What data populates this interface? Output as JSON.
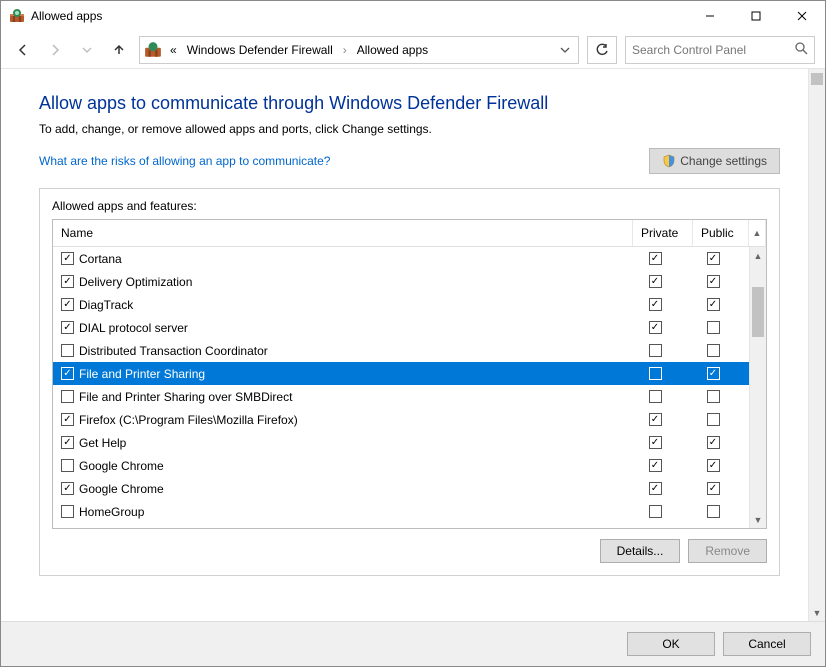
{
  "window": {
    "title": "Allowed apps"
  },
  "breadcrumb": {
    "prefix": "«",
    "seg1": "Windows Defender Firewall",
    "seg2": "Allowed apps"
  },
  "search": {
    "placeholder": "Search Control Panel"
  },
  "page": {
    "heading": "Allow apps to communicate through Windows Defender Firewall",
    "subheading": "To add, change, or remove allowed apps and ports, click Change settings.",
    "risks_link": "What are the risks of allowing an app to communicate?",
    "change_settings": "Change settings",
    "panel_label": "Allowed apps and features:",
    "columns": {
      "name": "Name",
      "private": "Private",
      "public": "Public"
    },
    "details_btn": "Details...",
    "remove_btn": "Remove"
  },
  "rows": [
    {
      "enabled": true,
      "name": "Cortana",
      "private": true,
      "public": true,
      "selected": false
    },
    {
      "enabled": true,
      "name": "Delivery Optimization",
      "private": true,
      "public": true,
      "selected": false
    },
    {
      "enabled": true,
      "name": "DiagTrack",
      "private": true,
      "public": true,
      "selected": false
    },
    {
      "enabled": true,
      "name": "DIAL protocol server",
      "private": true,
      "public": false,
      "selected": false
    },
    {
      "enabled": false,
      "name": "Distributed Transaction Coordinator",
      "private": false,
      "public": false,
      "selected": false
    },
    {
      "enabled": true,
      "name": "File and Printer Sharing",
      "private": false,
      "public": true,
      "selected": true
    },
    {
      "enabled": false,
      "name": "File and Printer Sharing over SMBDirect",
      "private": false,
      "public": false,
      "selected": false
    },
    {
      "enabled": true,
      "name": "Firefox (C:\\Program Files\\Mozilla Firefox)",
      "private": true,
      "public": false,
      "selected": false
    },
    {
      "enabled": true,
      "name": "Get Help",
      "private": true,
      "public": true,
      "selected": false
    },
    {
      "enabled": false,
      "name": "Google Chrome",
      "private": true,
      "public": true,
      "selected": false
    },
    {
      "enabled": true,
      "name": "Google Chrome",
      "private": true,
      "public": true,
      "selected": false
    },
    {
      "enabled": false,
      "name": "HomeGroup",
      "private": false,
      "public": false,
      "selected": false
    }
  ],
  "footer": {
    "ok": "OK",
    "cancel": "Cancel"
  }
}
